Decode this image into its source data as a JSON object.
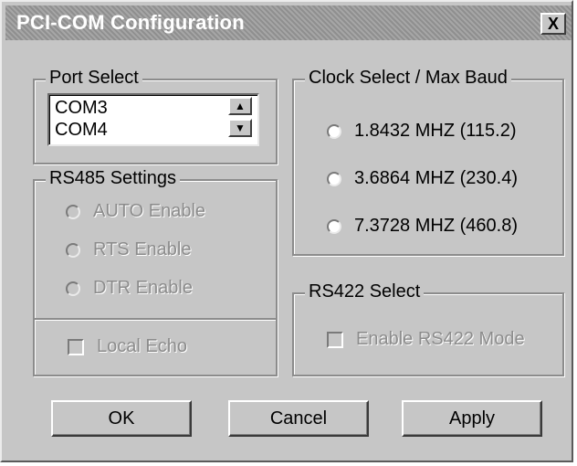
{
  "window": {
    "title": "PCI-COM Configuration",
    "close_label": "X"
  },
  "port_select": {
    "legend": "Port Select",
    "items": [
      "COM3",
      "COM4"
    ],
    "up_icon": "arrow-up-icon",
    "down_icon": "arrow-down-icon"
  },
  "rs485": {
    "legend": "RS485 Settings",
    "options": [
      "AUTO Enable",
      "RTS Enable",
      "DTR Enable"
    ],
    "local_echo": "Local Echo"
  },
  "clock_select": {
    "legend": "Clock Select / Max Baud",
    "options": [
      "1.8432 MHZ (115.2)",
      "3.6864 MHZ (230.4)",
      "7.3728 MHZ (460.8)"
    ]
  },
  "rs422": {
    "legend": "RS422 Select",
    "enable_label": "Enable RS422 Mode"
  },
  "buttons": {
    "ok": "OK",
    "cancel": "Cancel",
    "apply": "Apply"
  }
}
